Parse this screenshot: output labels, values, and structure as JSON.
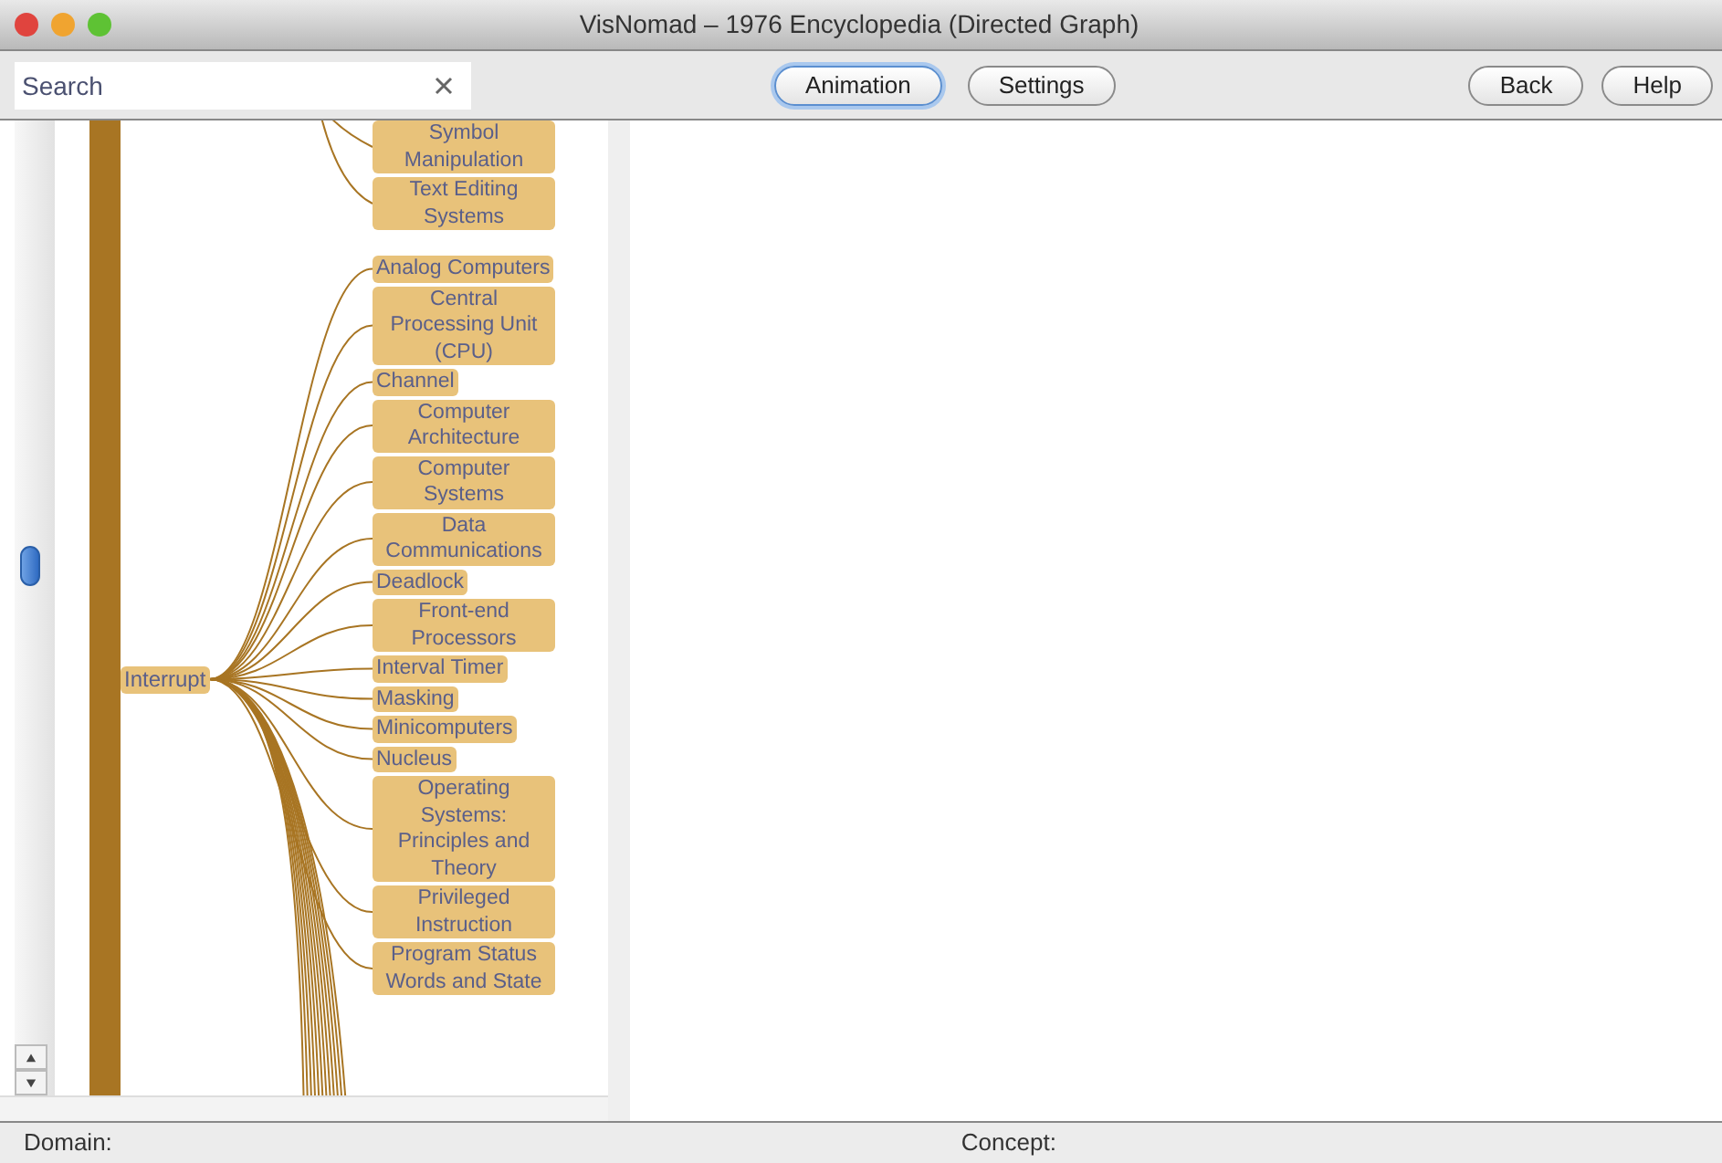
{
  "window": {
    "title": "VisNomad – 1976 Encyclopedia (Directed Graph)"
  },
  "toolbar": {
    "search": {
      "placeholder": "Search"
    },
    "buttons": [
      {
        "label": "Animation",
        "focused": true
      },
      {
        "label": "Settings",
        "focused": false
      },
      {
        "label": "Back",
        "focused": false
      },
      {
        "label": "Help",
        "focused": false
      }
    ]
  },
  "graph": {
    "top_nodes": [
      {
        "label": "Symbol Manipulation"
      },
      {
        "label": "Text Editing Systems"
      }
    ],
    "hub": {
      "label": "Interrupt",
      "children": [
        {
          "label": "Analog Computers"
        },
        {
          "label": "Central Processing Unit (CPU)"
        },
        {
          "label": "Channel"
        },
        {
          "label": "Computer Architecture"
        },
        {
          "label": "Computer Systems"
        },
        {
          "label": "Data Communications"
        },
        {
          "label": "Deadlock"
        },
        {
          "label": "Front-end Processors"
        },
        {
          "label": "Interval Timer"
        },
        {
          "label": "Masking"
        },
        {
          "label": "Minicomputers"
        },
        {
          "label": "Nucleus"
        },
        {
          "label": "Operating Systems: Principles and Theory"
        },
        {
          "label": "Privileged Instruction"
        },
        {
          "label": "Program Status Words and State"
        }
      ]
    }
  },
  "status_bar": {
    "domain": "Domain:",
    "concept": "Concept:"
  }
}
